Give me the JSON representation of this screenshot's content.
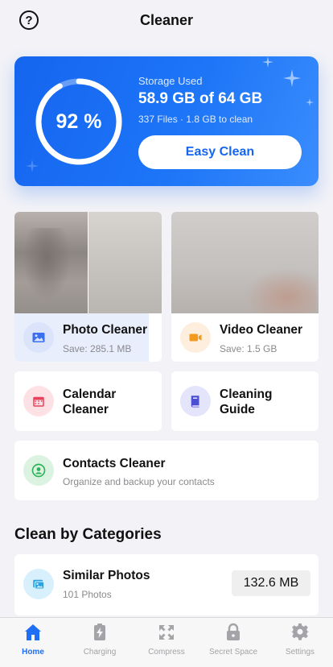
{
  "header": {
    "title": "Cleaner",
    "help_glyph": "?"
  },
  "storage": {
    "percent_label": "92 %",
    "percent_value": 92,
    "label": "Storage Used",
    "value": "58.9 GB of 64 GB",
    "sub": "337 Files · 1.8 GB to clean",
    "button": "Easy Clean"
  },
  "photo_cleaner": {
    "title": "Photo Cleaner",
    "save": "Save: 285.1 MB",
    "icon": "image-icon"
  },
  "video_cleaner": {
    "title": "Video Cleaner",
    "save": "Save: 1.5 GB",
    "icon": "video-camera-icon"
  },
  "calendar_cleaner": {
    "title_line1": "Calendar",
    "title_line2": "Cleaner",
    "icon": "calendar-icon"
  },
  "cleaning_guide": {
    "title_line1": "Cleaning",
    "title_line2": "Guide",
    "icon": "book-icon"
  },
  "contacts_cleaner": {
    "title": "Contacts Cleaner",
    "sub": "Organize and backup your contacts",
    "icon": "contact-icon"
  },
  "categories": {
    "title": "Clean by Categories",
    "items": [
      {
        "title": "Similar Photos",
        "sub": "101 Photos",
        "size": "132.6 MB",
        "icon": "photos-icon"
      }
    ]
  },
  "tabs": [
    {
      "label": "Home",
      "icon": "home-icon",
      "active": true
    },
    {
      "label": "Charging",
      "icon": "battery-icon",
      "active": false
    },
    {
      "label": "Compress",
      "icon": "compress-icon",
      "active": false
    },
    {
      "label": "Secret Space",
      "icon": "lock-icon",
      "active": false
    },
    {
      "label": "Settings",
      "icon": "gear-icon",
      "active": false
    }
  ],
  "colors": {
    "accent": "#1f6ff4",
    "card_gradient_start": "#1565ef",
    "card_gradient_end": "#3a8dfd"
  }
}
